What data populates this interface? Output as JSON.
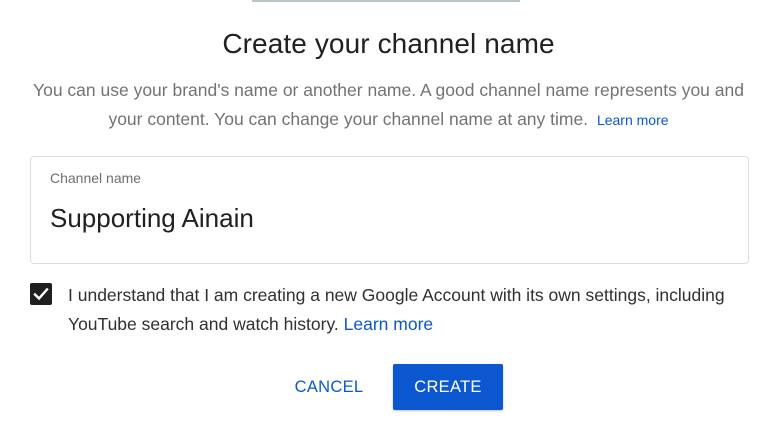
{
  "dialog": {
    "title": "Create your channel name",
    "description": "You can use your brand's name or another name. A good channel name represents you and your content. You can change your channel name at any time.",
    "description_link": "Learn more"
  },
  "channel_field": {
    "label": "Channel name",
    "value": "Supporting Ainain"
  },
  "consent": {
    "checked": true,
    "text": "I understand that I am creating a new Google Account with its own settings, including YouTube search and watch history.",
    "link": "Learn more"
  },
  "actions": {
    "cancel_label": "CANCEL",
    "create_label": "CREATE"
  },
  "colors": {
    "accent": "#0b57d0",
    "checkbox": "#1f1f1f"
  }
}
